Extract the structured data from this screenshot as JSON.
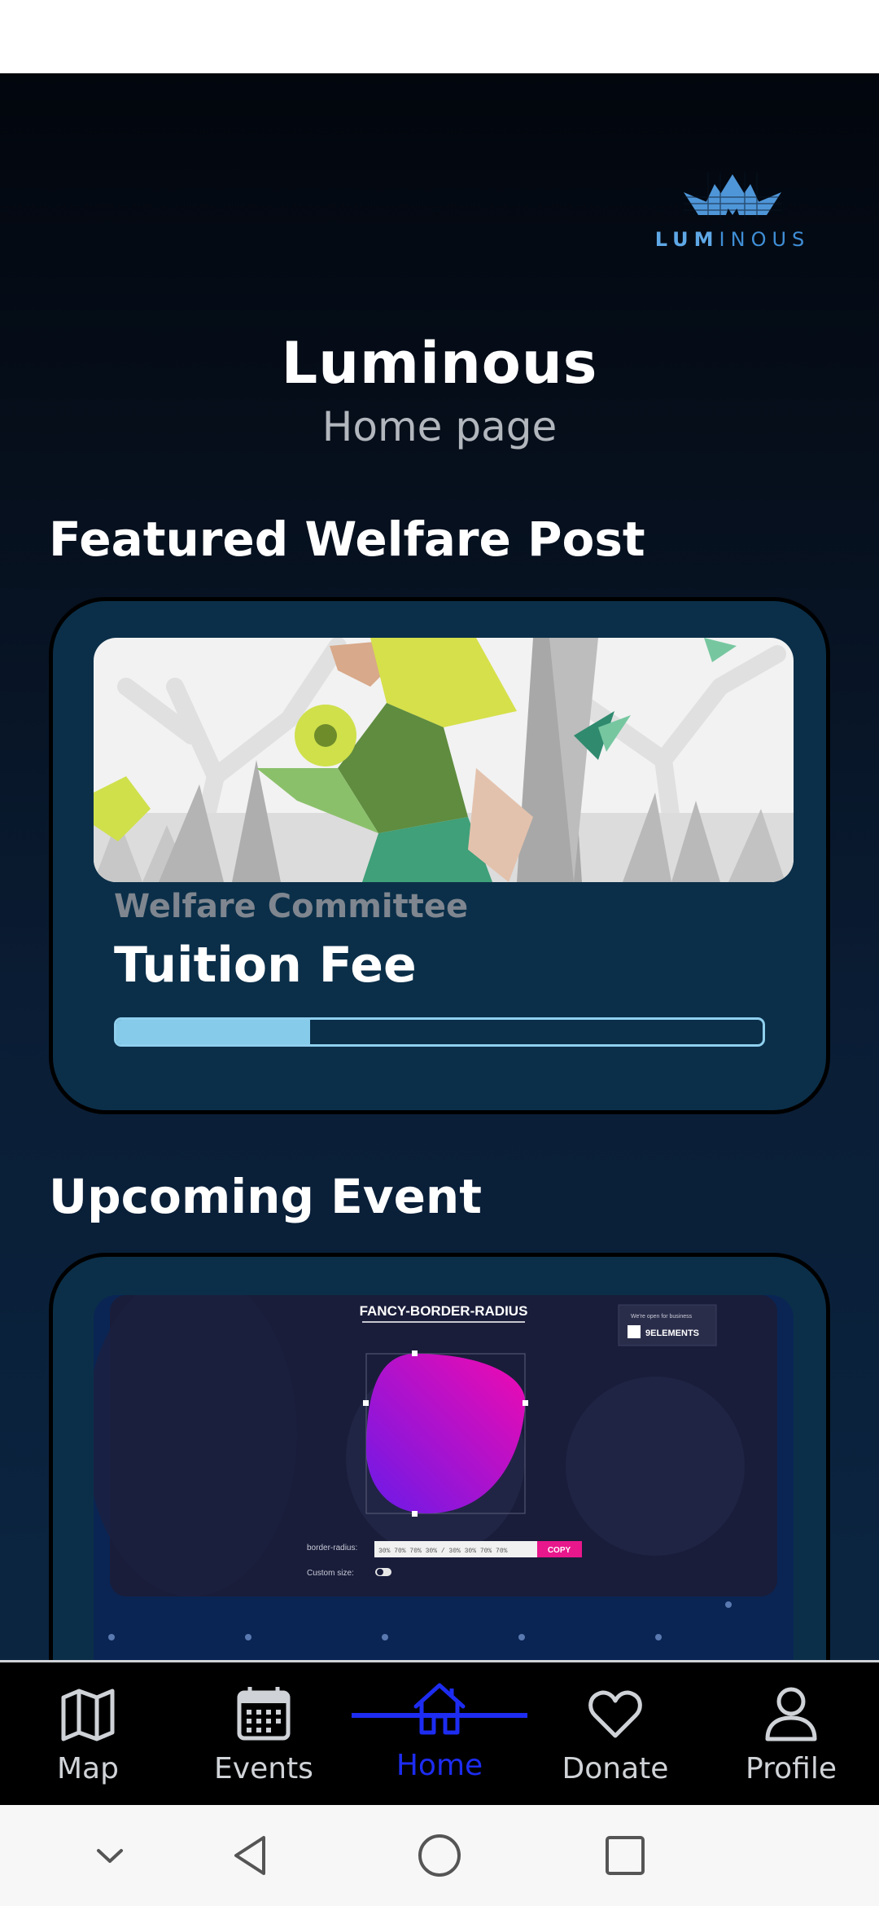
{
  "brand": {
    "logo_text_a": "LUM",
    "logo_text_b": "INOUS"
  },
  "header": {
    "title": "Luminous",
    "subtitle": "Home page"
  },
  "featured": {
    "heading": "Featured Welfare Post",
    "organization": "Welfare Committee",
    "title": "Tuition Fee",
    "progress": 0.3
  },
  "upcoming": {
    "heading": "Upcoming Event",
    "image_title": "FANCY-BORDER-RADIUS",
    "border_radius_label": "border-radius:",
    "border_radius_value": "30% 70% 70% 30% / 30% 30% 70% 70%",
    "copy_label": "COPY",
    "custom_size_label": "Custom size:",
    "badge_top": "We're open for business",
    "badge_name": "9ELEMENTS"
  },
  "nav": {
    "items": [
      {
        "label": "Map"
      },
      {
        "label": "Events"
      },
      {
        "label": "Home"
      },
      {
        "label": "Donate"
      },
      {
        "label": "Profile"
      }
    ],
    "active_color": "#1d2cf0"
  }
}
